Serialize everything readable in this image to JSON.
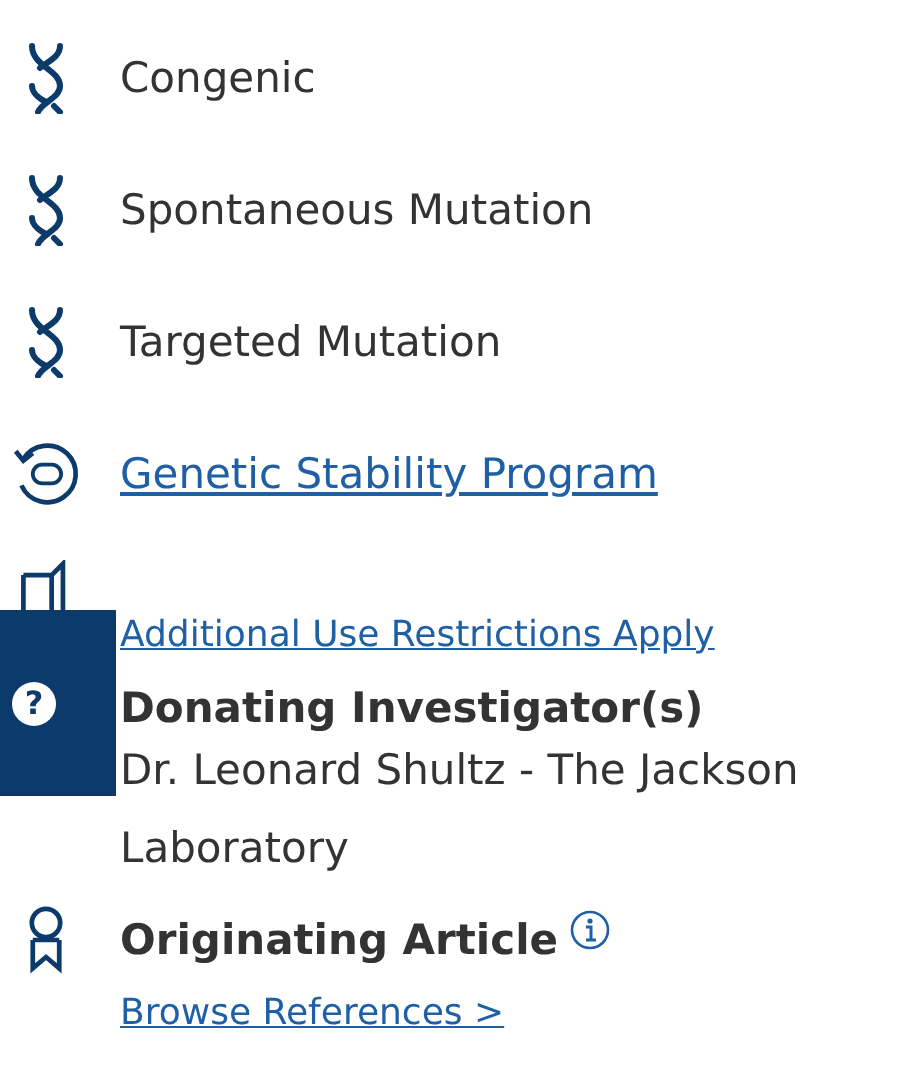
{
  "model_types": [
    {
      "label": "Congenic"
    },
    {
      "label": "Spontaneous Mutation"
    },
    {
      "label": "Targeted Mutation"
    }
  ],
  "program_link": "Genetic Stability Program",
  "restrictions_link": "Additional Use Restrictions Apply",
  "donating": {
    "heading": "Donating Investigator(s)",
    "value": "Dr. Leonard Shultz - The Jackson Laboratory"
  },
  "article": {
    "heading": "Originating Article",
    "link": "Browse References >"
  },
  "help_tab": {
    "icon": "?"
  }
}
